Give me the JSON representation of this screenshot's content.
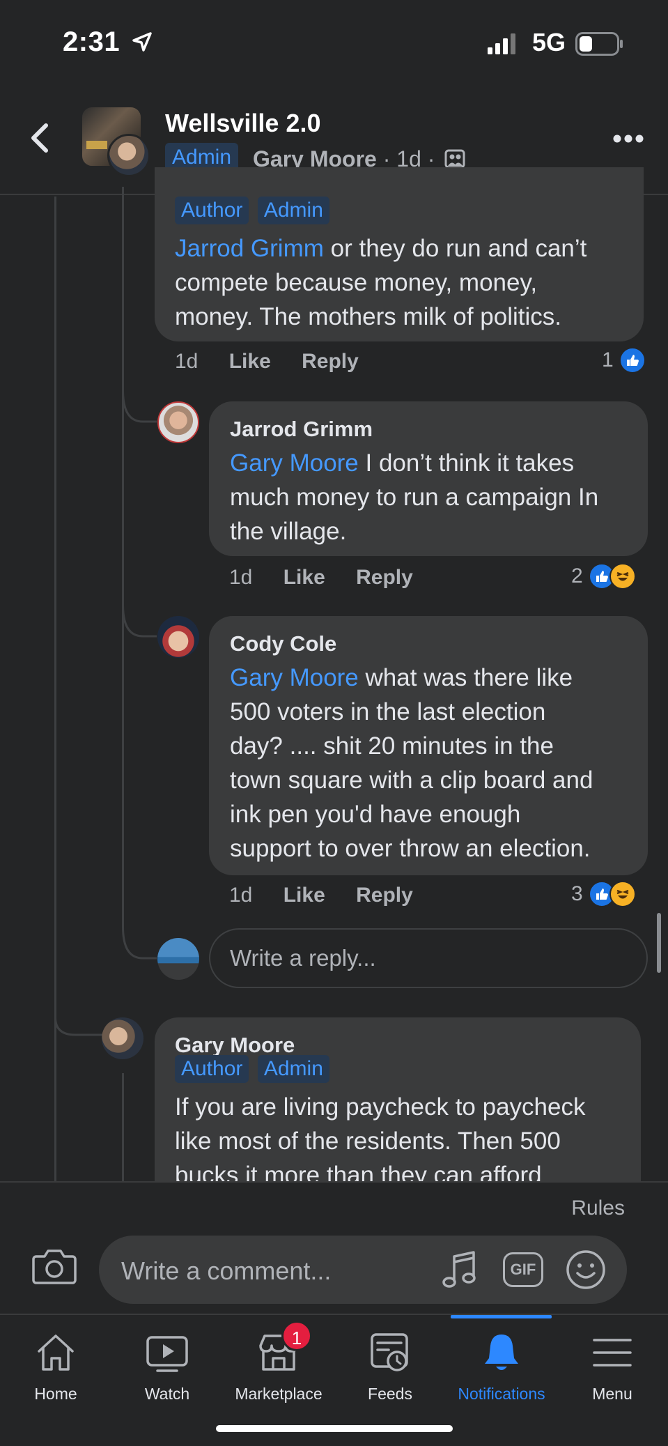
{
  "status": {
    "time": "2:31",
    "network": "5G"
  },
  "header": {
    "group_name": "Wellsville 2.0",
    "admin_badge": "Admin",
    "poster": "Gary Moore",
    "meta": "· 1d ·"
  },
  "comments": [
    {
      "tags": [
        "Author",
        "Admin"
      ],
      "mention": "Jarrod Grimm",
      "text_lines": [
        " or they do run and can’t",
        "compete because money, money,",
        "money. The mothers milk of politics."
      ],
      "time": "1d",
      "like": "Like",
      "reply": "Reply",
      "reaction_count": "1"
    },
    {
      "name": "Jarrod Grimm",
      "mention": "Gary Moore",
      "text_lines": [
        " I don’t think it takes",
        "much money to run a campaign In",
        "the village."
      ],
      "time": "1d",
      "like": "Like",
      "reply": "Reply",
      "reaction_count": "2"
    },
    {
      "name": "Cody Cole",
      "mention": "Gary Moore",
      "text_lines": [
        " what was there like",
        "500 voters in the last election",
        "day? .... shit 20 minutes in the",
        "town square with a clip board and",
        "ink pen you'd have enough",
        "support to over throw an election."
      ],
      "time": "1d",
      "like": "Like",
      "reply": "Reply",
      "reaction_count": "3"
    },
    {
      "name": "Gary Moore",
      "tags": [
        "Author",
        "Admin"
      ],
      "text_lines": [
        "If you are living paycheck to paycheck",
        "like most of the residents. Then 500",
        "bucks it more than they can afford"
      ]
    }
  ],
  "reply_placeholder": "Write a reply...",
  "composer": {
    "rules": "Rules",
    "placeholder": "Write a comment...",
    "gif": "GIF"
  },
  "tabs": [
    {
      "label": "Home",
      "icon": "home-icon"
    },
    {
      "label": "Watch",
      "icon": "watch-icon"
    },
    {
      "label": "Marketplace",
      "icon": "marketplace-icon",
      "badge": "1"
    },
    {
      "label": "Feeds",
      "icon": "feeds-icon"
    },
    {
      "label": "Notifications",
      "icon": "bell-icon",
      "active": true
    },
    {
      "label": "Menu",
      "icon": "menu-icon"
    }
  ],
  "colors": {
    "background": "#242526",
    "bubble": "#3a3b3c",
    "accent": "#4599ff",
    "badge": "#e41e3f"
  }
}
